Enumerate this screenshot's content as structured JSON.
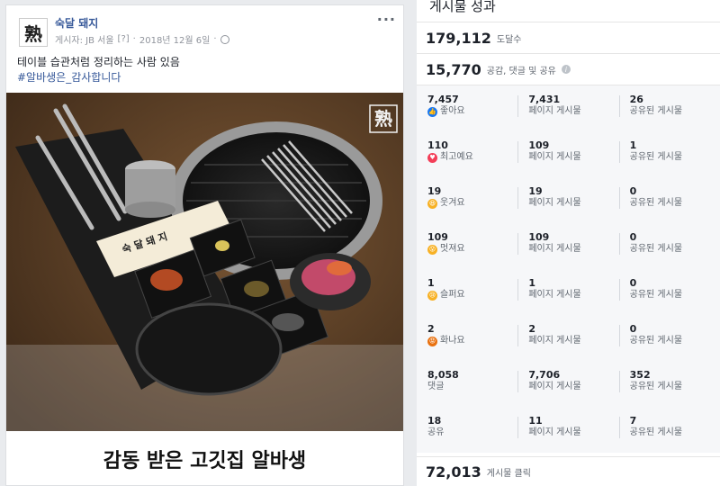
{
  "post": {
    "page_name": "숙달 돼지",
    "avatar_char": "熟",
    "meta_author": "게시자: JB 서울",
    "meta_help": "[?]",
    "meta_date": "2018년 12월 6일",
    "caption_line1": "테이블 습관처럼 정리하는 사람 있음",
    "caption_tag": "#알바생은_감사합니다",
    "photo_logo": "熟",
    "photo_sign": "숙 달 돼 지",
    "photo_title": "감동 받은 고깃집 알바생",
    "more_label": "···"
  },
  "insights": {
    "title": "게시물 성과",
    "reach_value": "179,112",
    "reach_label": "도달수",
    "engage_value": "15,770",
    "engage_label": "공감, 댓글 및 공유",
    "rows": [
      {
        "label": "좋아요",
        "total": "7,457",
        "page": "7,431",
        "shared": "26",
        "icon": "like-icon",
        "color": "#1877f2",
        "glyph": "👍"
      },
      {
        "label": "최고예요",
        "total": "110",
        "page": "109",
        "shared": "1",
        "icon": "love-icon",
        "color": "#f33e58",
        "glyph": "♥"
      },
      {
        "label": "웃겨요",
        "total": "19",
        "page": "19",
        "shared": "0",
        "icon": "haha-icon",
        "color": "#f7b125",
        "glyph": "😆"
      },
      {
        "label": "멋져요",
        "total": "109",
        "page": "109",
        "shared": "0",
        "icon": "wow-icon",
        "color": "#f7b125",
        "glyph": "😮"
      },
      {
        "label": "슬퍼요",
        "total": "1",
        "page": "1",
        "shared": "0",
        "icon": "sad-icon",
        "color": "#f7b125",
        "glyph": "😢"
      },
      {
        "label": "화나요",
        "total": "2",
        "page": "2",
        "shared": "0",
        "icon": "angry-icon",
        "color": "#e9710f",
        "glyph": "😡"
      },
      {
        "label": "댓글",
        "total": "8,058",
        "page": "7,706",
        "shared": "352",
        "icon": "",
        "color": "",
        "glyph": ""
      },
      {
        "label": "공유",
        "total": "18",
        "page": "11",
        "shared": "7",
        "icon": "",
        "color": "",
        "glyph": ""
      }
    ],
    "page_label": "페이지 게시물",
    "shared_label": "공유된 게시물",
    "clicks_value": "72,013",
    "clicks_label": "게시물 클릭"
  }
}
